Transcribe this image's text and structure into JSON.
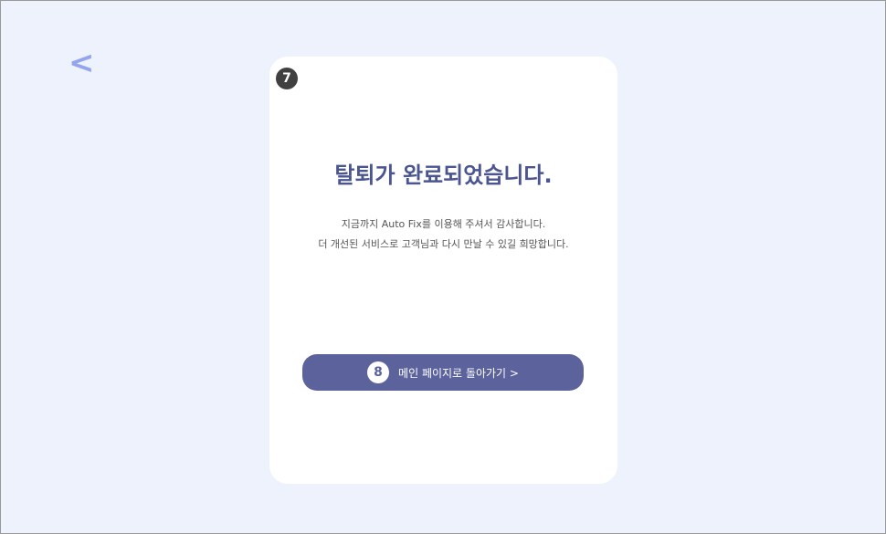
{
  "nav": {
    "back_label": "<"
  },
  "card": {
    "marker_top": "7",
    "title": "탈퇴가 완료되었습니다.",
    "message_line1": "지금까지 Auto Fix를 이용해 주셔서 감사합니다.",
    "message_line2": "더 개선된 서비스로 고객님과 다시 만날 수 있길 희망합니다.",
    "button_marker": "8",
    "button_label": "메인 페이지로 돌아가기 >"
  },
  "colors": {
    "background": "#eef2fc",
    "card": "#ffffff",
    "accent": "#5b629c",
    "title": "#4b5590",
    "back_arrow": "#93a5ef"
  }
}
